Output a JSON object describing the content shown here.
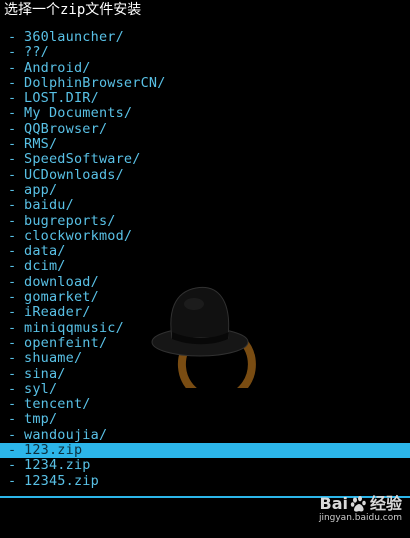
{
  "header": {
    "title": "选择一个zip文件安装"
  },
  "files": [
    {
      "dash": "-",
      "name": "360launcher/"
    },
    {
      "dash": "-",
      "name": "??/"
    },
    {
      "dash": "-",
      "name": "Android/"
    },
    {
      "dash": "-",
      "name": "DolphinBrowserCN/"
    },
    {
      "dash": "-",
      "name": "LOST.DIR/"
    },
    {
      "dash": "-",
      "name": "My Documents/"
    },
    {
      "dash": "-",
      "name": "QQBrowser/"
    },
    {
      "dash": "-",
      "name": "RMS/"
    },
    {
      "dash": "-",
      "name": "SpeedSoftware/"
    },
    {
      "dash": "-",
      "name": "UCDownloads/"
    },
    {
      "dash": "-",
      "name": "app/"
    },
    {
      "dash": "-",
      "name": "baidu/"
    },
    {
      "dash": "-",
      "name": "bugreports/"
    },
    {
      "dash": "-",
      "name": "clockworkmod/"
    },
    {
      "dash": "-",
      "name": "data/"
    },
    {
      "dash": "-",
      "name": "dcim/"
    },
    {
      "dash": "-",
      "name": "download/"
    },
    {
      "dash": "-",
      "name": "gomarket/"
    },
    {
      "dash": "-",
      "name": "iReader/"
    },
    {
      "dash": "-",
      "name": "miniqqmusic/"
    },
    {
      "dash": "-",
      "name": "openfeint/"
    },
    {
      "dash": "-",
      "name": "shuame/"
    },
    {
      "dash": "-",
      "name": "sina/"
    },
    {
      "dash": "-",
      "name": "syl/"
    },
    {
      "dash": "-",
      "name": "tencent/"
    },
    {
      "dash": "-",
      "name": "tmp/"
    },
    {
      "dash": "-",
      "name": "wandoujia/"
    },
    {
      "dash": "-",
      "name": "123.zip"
    },
    {
      "dash": "-",
      "name": "1234.zip"
    },
    {
      "dash": "-",
      "name": "12345.zip"
    }
  ],
  "selected_file": "123.zip",
  "watermark": {
    "brand_left": "Bai",
    "brand_right": "经验",
    "url": "jingyan.baidu.com"
  },
  "colors": {
    "background": "#000000",
    "list_text": "#59c1e6",
    "highlight": "#2cb6ea",
    "title_text": "#ffffff"
  },
  "icons": {
    "logo": "clockworkmod-hat-logo",
    "paw": "baidu-paw-icon"
  }
}
